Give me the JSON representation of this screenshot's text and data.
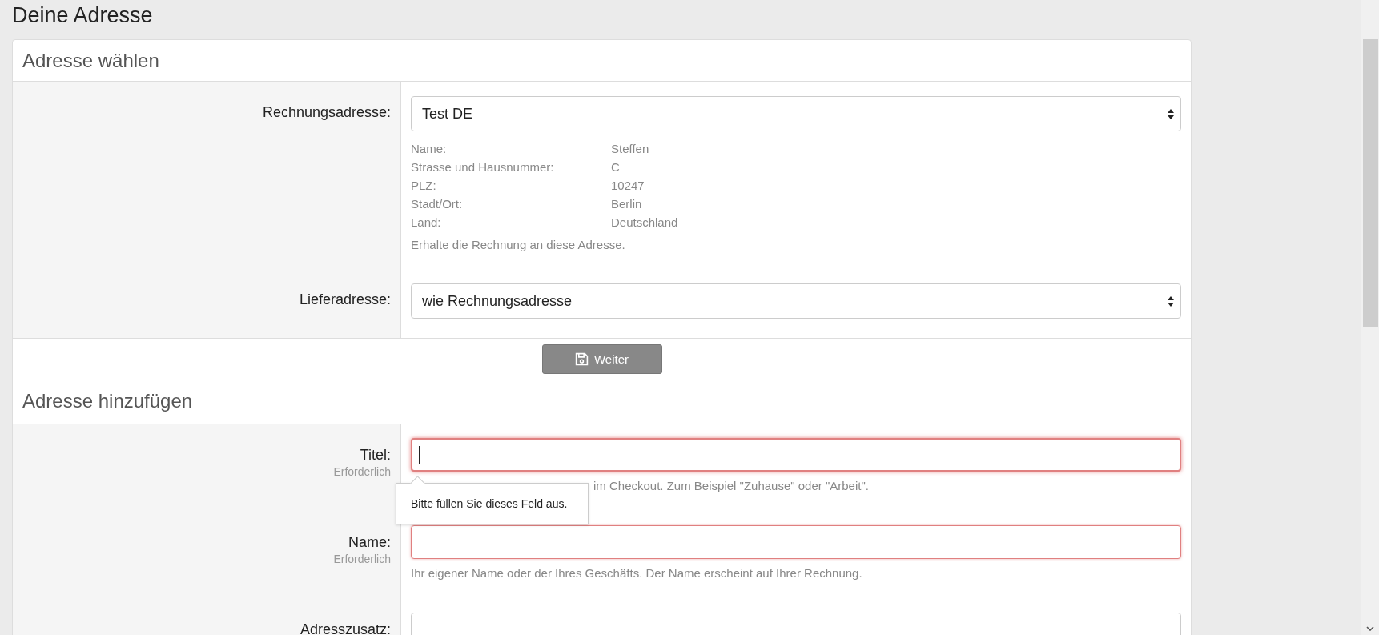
{
  "page_title": "Deine Adresse",
  "choose_section": {
    "title": "Adresse wählen",
    "billing": {
      "label": "Rechnungsadresse:",
      "value": "Test DE",
      "details": [
        {
          "key": "Name:",
          "value": "Steffen"
        },
        {
          "key": "Strasse und Hausnummer:",
          "value": "C"
        },
        {
          "key": "PLZ:",
          "value": "10247"
        },
        {
          "key": "Stadt/Ort:",
          "value": "Berlin"
        },
        {
          "key": "Land:",
          "value": "Deutschland"
        }
      ],
      "help": "Erhalte die Rechnung an diese Adresse."
    },
    "shipping": {
      "label": "Lieferadresse:",
      "value": "wie Rechnungsadresse"
    }
  },
  "continue_button": "Weiter",
  "add_section": {
    "title": "Adresse hinzufügen",
    "fields": [
      {
        "label": "Titel:",
        "required": "Erforderlich",
        "invalid": true,
        "focused": true,
        "help": "im Checkout. Zum Beispiel \"Zuhause\" oder \"Arbeit\".",
        "tooltip": "Bitte füllen Sie dieses Feld aus."
      },
      {
        "label": "Name:",
        "required": "Erforderlich",
        "invalid": true,
        "focused": false,
        "help": "Ihr eigener Name oder der Ihres Geschäfts. Der Name erscheint auf Ihrer Rechnung."
      },
      {
        "label": "Adresszusatz:",
        "invalid": false,
        "focused": false
      }
    ]
  }
}
